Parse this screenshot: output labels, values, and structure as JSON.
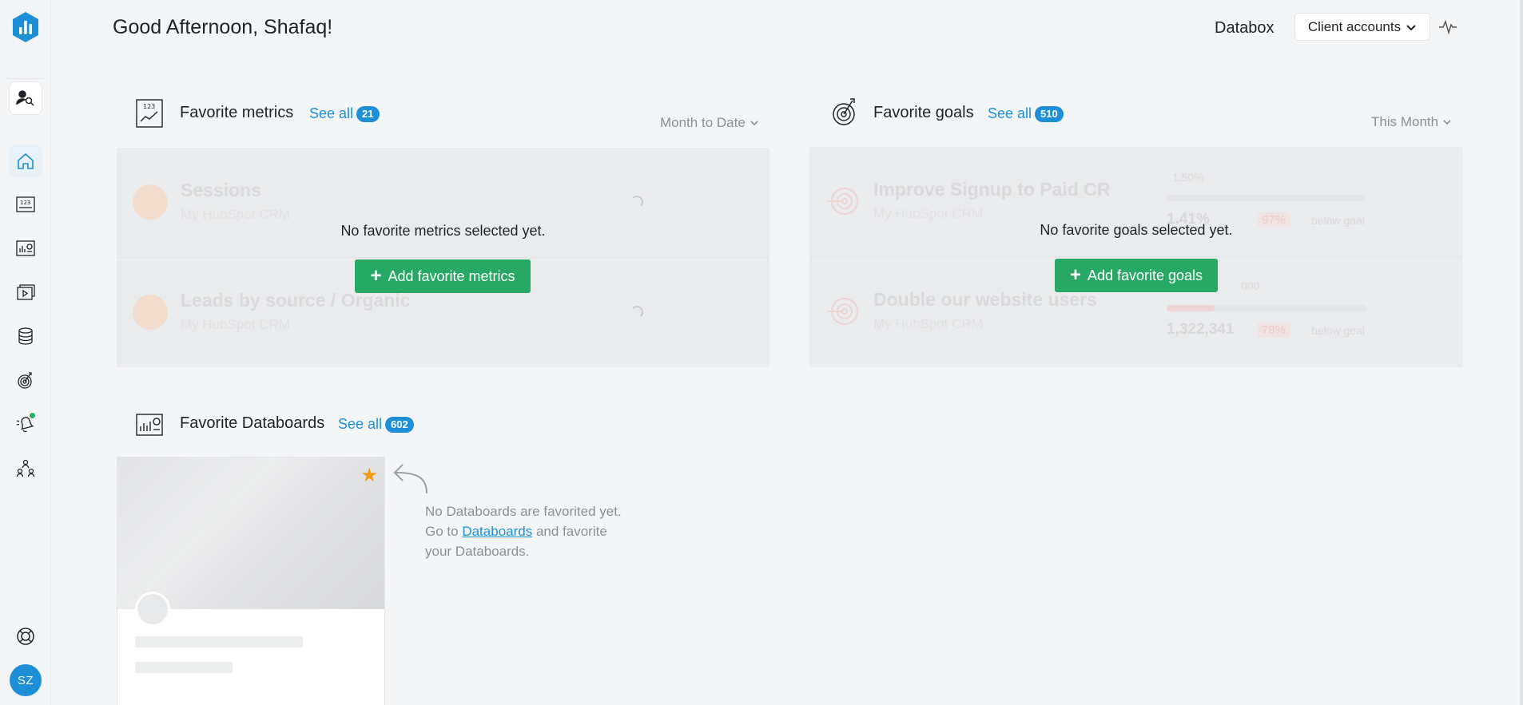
{
  "header": {
    "greeting": "Good Afternoon, Shafaq!",
    "brand": "Databox",
    "client_accounts_label": "Client accounts"
  },
  "sidebar": {
    "items": [
      {
        "name": "client-manager",
        "icon": "user-search-icon"
      },
      {
        "name": "home",
        "icon": "home-icon"
      },
      {
        "name": "metrics",
        "icon": "metrics-123-icon"
      },
      {
        "name": "databoards",
        "icon": "databoard-icon"
      },
      {
        "name": "reports",
        "icon": "report-play-icon"
      },
      {
        "name": "data-sources",
        "icon": "database-icon"
      },
      {
        "name": "goals",
        "icon": "target-icon"
      },
      {
        "name": "alerts",
        "icon": "bell-icon"
      },
      {
        "name": "team",
        "icon": "team-icon"
      },
      {
        "name": "help",
        "icon": "lifebuoy-icon"
      }
    ],
    "avatar_initials": "SZ"
  },
  "favorite_metrics": {
    "title": "Favorite metrics",
    "see_all": "See all",
    "count": "21",
    "period": "Month to Date",
    "empty_message": "No favorite metrics selected yet.",
    "add_label": "Add favorite metrics",
    "ghost_rows": [
      {
        "title": "Sessions",
        "source": "My HubSpot CRM"
      },
      {
        "title": "Leads by source / Organic",
        "source": "My HubSpot CRM"
      }
    ]
  },
  "favorite_goals": {
    "title": "Favorite goals",
    "see_all": "See all",
    "count": "510",
    "period": "This Month",
    "empty_message": "No favorite goals selected yet.",
    "add_label": "Add favorite goals",
    "ghost_rows": [
      {
        "title": "Improve Signup to Paid CR",
        "source": "My HubSpot CRM",
        "target": "1.50%",
        "value": "1.41%",
        "delta": "97%",
        "note": "below goal"
      },
      {
        "title": "Double our website users",
        "source": "My HubSpot CRM",
        "target": "000",
        "value": "1,322,341",
        "delta": "78%",
        "note": "below goal"
      }
    ]
  },
  "favorite_databoards": {
    "title": "Favorite Databoards",
    "see_all": "See all",
    "count": "602",
    "empty_line1": "No Databoards are favorited yet.",
    "empty_line2_prefix": "Go to",
    "empty_link": "Databoards",
    "empty_line2_suffix": "and favorite",
    "empty_line3": "your Databoards."
  },
  "colors": {
    "accent": "#1d8fd8",
    "button_green": "#27a864",
    "star": "#f39c12",
    "background": "#f4f5f7"
  }
}
